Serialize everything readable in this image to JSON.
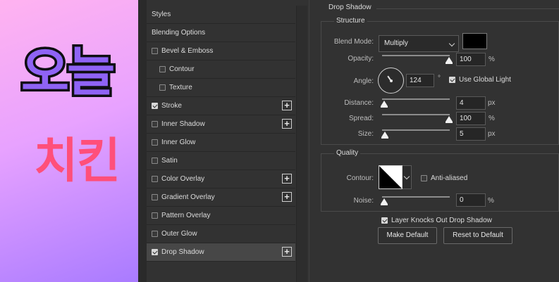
{
  "canvas": {
    "line1": "오늘",
    "line2": "치킨"
  },
  "styles_list": {
    "items": [
      {
        "label": "Styles",
        "type": "header"
      },
      {
        "label": "Blending Options",
        "type": "header"
      },
      {
        "label": "Bevel & Emboss",
        "checked": false
      },
      {
        "label": "Contour",
        "checked": false,
        "sub": true
      },
      {
        "label": "Texture",
        "checked": false,
        "sub": true
      },
      {
        "label": "Stroke",
        "checked": true,
        "addable": true
      },
      {
        "label": "Inner Shadow",
        "checked": false,
        "addable": true
      },
      {
        "label": "Inner Glow",
        "checked": false
      },
      {
        "label": "Satin",
        "checked": false
      },
      {
        "label": "Color Overlay",
        "checked": false,
        "addable": true
      },
      {
        "label": "Gradient Overlay",
        "checked": false,
        "addable": true
      },
      {
        "label": "Pattern Overlay",
        "checked": false
      },
      {
        "label": "Outer Glow",
        "checked": false
      },
      {
        "label": "Drop Shadow",
        "checked": true,
        "addable": true,
        "active": true
      }
    ],
    "add_icon": "+"
  },
  "panel": {
    "title": "Drop Shadow",
    "structure": {
      "label": "Structure",
      "blend_mode_label": "Blend Mode:",
      "blend_mode_value": "Multiply",
      "shadow_color": "#000000",
      "opacity_label": "Opacity:",
      "opacity_value": "100",
      "opacity_unit": "%",
      "angle_label": "Angle:",
      "angle_value": "124",
      "angle_unit": "°",
      "use_global_light_label": "Use Global Light",
      "use_global_light": true,
      "distance_label": "Distance:",
      "distance_value": "4",
      "distance_unit": "px",
      "spread_label": "Spread:",
      "spread_value": "100",
      "spread_unit": "%",
      "size_label": "Size:",
      "size_value": "5",
      "size_unit": "px"
    },
    "quality": {
      "label": "Quality",
      "contour_label": "Contour:",
      "anti_aliased_label": "Anti-aliased",
      "anti_aliased": false,
      "noise_label": "Noise:",
      "noise_value": "0",
      "noise_unit": "%"
    },
    "layer_knocks_out_label": "Layer Knocks Out Drop Shadow",
    "layer_knocks_out": true,
    "make_default_label": "Make Default",
    "reset_default_label": "Reset to Default"
  }
}
